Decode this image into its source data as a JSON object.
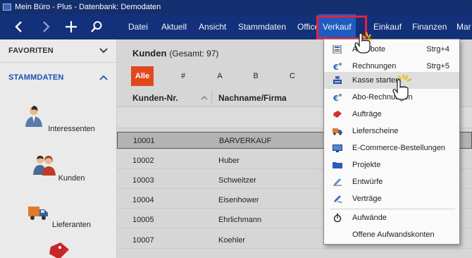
{
  "window": {
    "title": "Mein Büro - Plus - Datenbank: Demodaten"
  },
  "menubar": {
    "items": [
      "Datei",
      "Aktuell",
      "Ansicht",
      "Stammdaten",
      "Office",
      "Verkauf",
      "Einkauf",
      "Finanzen",
      "Mar"
    ],
    "active": "Verkauf"
  },
  "sidebar": {
    "favorites_label": "FAVORITEN",
    "stammdaten_label": "STAMMDATEN",
    "entries": [
      "Interessenten",
      "Kunden",
      "Lieferanten"
    ]
  },
  "main": {
    "title": "Kunden",
    "subtitle": "(Gesamt: 97)",
    "letters": [
      "Alle",
      "#",
      "A",
      "B",
      "C"
    ],
    "active_letter": "Alle",
    "columns": [
      "Kunden-Nr.",
      "Nachname/Firma"
    ],
    "rows": [
      {
        "nr": "10001",
        "name": "BARVERKAUF"
      },
      {
        "nr": "10002",
        "name": "Huber"
      },
      {
        "nr": "10003",
        "name": "Schweitzer"
      },
      {
        "nr": "10004",
        "name": "Eisenhower"
      },
      {
        "nr": "10005",
        "name": "Ehrlichmann"
      },
      {
        "nr": "10007",
        "name": "Koehler"
      }
    ]
  },
  "dropdown": {
    "items": [
      {
        "label": "Angebote",
        "shortcut": "Strg+4",
        "icon": "offer-icon"
      },
      {
        "label": "Rechnungen",
        "shortcut": "Strg+5",
        "icon": "invoice-icon"
      },
      {
        "label": "Kasse starten",
        "shortcut": "",
        "icon": "cash-register-icon"
      },
      {
        "label": "Abo-Rechnungen",
        "shortcut": "",
        "icon": "subscription-invoice-icon"
      },
      {
        "label": "Aufträge",
        "shortcut": "",
        "icon": "order-icon"
      },
      {
        "label": "Lieferscheine",
        "shortcut": "",
        "icon": "delivery-icon"
      },
      {
        "label": "E-Commerce-Bestellungen",
        "shortcut": "",
        "icon": "ecommerce-icon"
      },
      {
        "label": "Projekte",
        "shortcut": "",
        "icon": "folder-icon"
      },
      {
        "label": "Entwürfe",
        "shortcut": "",
        "icon": "draft-icon"
      },
      {
        "label": "Verträge",
        "shortcut": "",
        "icon": "contract-icon"
      },
      {
        "label": "Aufwände",
        "shortcut": "",
        "icon": "stopwatch-icon"
      },
      {
        "label": "Offene Aufwandskonten",
        "shortcut": "",
        "icon": ""
      }
    ]
  },
  "colors": {
    "titlebar": "#142f6e",
    "menubar": "#13307a",
    "active_menu": "#1e5cc2",
    "highlight": "#e8213a",
    "letter_active": "#e0491e",
    "stammdaten_accent": "#1f4fb0"
  }
}
